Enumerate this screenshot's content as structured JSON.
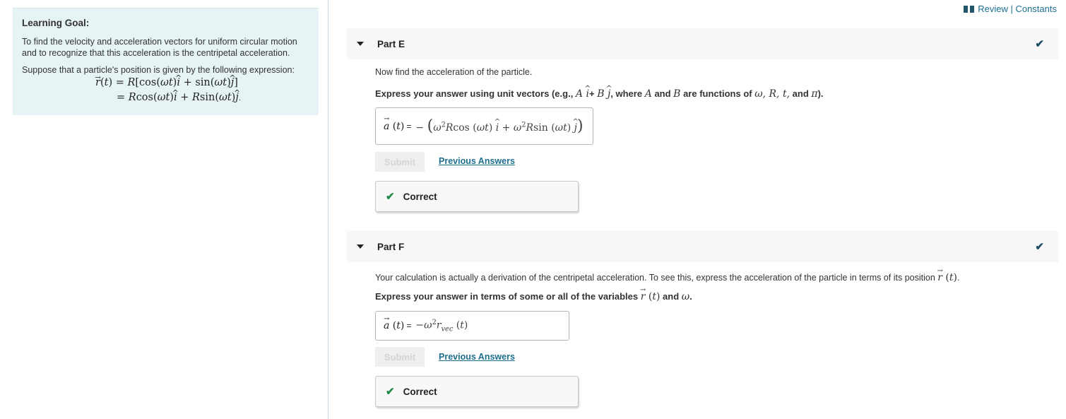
{
  "header": {
    "review_constants": "Review | Constants",
    "icon": "book-icon"
  },
  "learning_goal": {
    "title": "Learning Goal:",
    "text": "To find the velocity and acceleration vectors for uniform circular motion and to recognize that this acceleration is the centripetal acceleration.",
    "setup": "Suppose that a particle's position is given by the following expression:",
    "equation_line1": "r(t) = R[cos(ωt) î + sin(ωt) ĵ]",
    "equation_line2": "= R cos(ωt) î + R sin(ωt) ĵ."
  },
  "parts": [
    {
      "label": "Part E",
      "status_icon": "check-icon",
      "prompt": "Now find the acceleration of the particle.",
      "instruction_prefix": "Express your answer using unit vectors (e.g., ",
      "instruction_example": "A î + B ĵ",
      "instruction_mid": ", where ",
      "instruction_A": "A",
      "instruction_and": " and ",
      "instruction_B": "B",
      "instruction_suffix": " are functions of ",
      "instruction_vars": "ω, R, t,",
      "instruction_and2": " and ",
      "instruction_pi": "π",
      "instruction_end": ").",
      "answer_label": "a (t) =",
      "answer_value": "−(ω²R cos (ωt) î + ω²R sin (ωt) ĵ)",
      "submit_label": "Submit",
      "previous_answers_label": "Previous Answers",
      "result_label": "Correct"
    },
    {
      "label": "Part F",
      "status_icon": "check-icon",
      "prompt_text": "Your calculation is actually a derivation of the centripetal acceleration. To see this, express the acceleration of the particle in terms of its position ",
      "prompt_var": "r (t)",
      "prompt_end": ".",
      "instruction_text": "Express your answer in terms of some or all of the variables ",
      "instruction_var": "r (t)",
      "instruction_and": " and ",
      "instruction_omega": "ω",
      "instruction_end": ".",
      "answer_label": "a (t) =",
      "answer_value": "−ω²r_vec (t)",
      "submit_label": "Submit",
      "previous_answers_label": "Previous Answers",
      "result_label": "Correct"
    }
  ]
}
